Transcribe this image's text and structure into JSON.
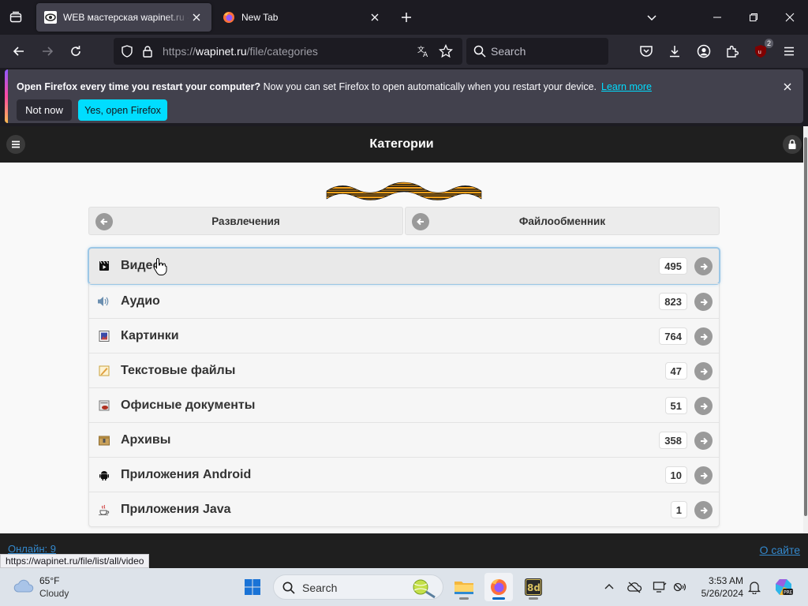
{
  "browser": {
    "tabs": [
      {
        "title": "WEB мастерская wapinet.ru - Ka",
        "active": true
      },
      {
        "title": "New Tab",
        "active": false
      }
    ],
    "url_prefix": "https://",
    "url_host": "wapinet.ru",
    "url_path": "/file/categories",
    "search_placeholder": "Search",
    "extensions_badge": "2"
  },
  "notification": {
    "bold_text": "Open Firefox every time you restart your computer?",
    "text": " Now you can set Firefox to open automatically when you restart your device.",
    "link": "Learn more",
    "not_now": "Not now",
    "yes": "Yes, open Firefox"
  },
  "page": {
    "title": "Категории",
    "prev_nav": "Развлечения",
    "next_nav": "Файлообменник",
    "categories": [
      {
        "label": "Видео",
        "count": "495",
        "icon": "video-icon"
      },
      {
        "label": "Аудио",
        "count": "823",
        "icon": "speaker-icon"
      },
      {
        "label": "Картинки",
        "count": "764",
        "icon": "picture-icon"
      },
      {
        "label": "Текстовые файлы",
        "count": "47",
        "icon": "text-file-icon"
      },
      {
        "label": "Офисные документы",
        "count": "51",
        "icon": "office-document-icon"
      },
      {
        "label": "Архивы",
        "count": "358",
        "icon": "archive-icon"
      },
      {
        "label": "Приложения Android",
        "count": "10",
        "icon": "android-icon"
      },
      {
        "label": "Приложения Java",
        "count": "1",
        "icon": "java-icon"
      }
    ],
    "online": "Онлайн: 9",
    "about": "О сайте",
    "status_url": "https://wapinet.ru/file/list/all/video"
  },
  "taskbar": {
    "temp": "65°F",
    "condition": "Cloudy",
    "search_placeholder": "Search",
    "time": "3:53 AM",
    "date": "5/26/2024"
  },
  "colors": {
    "accent": "#00ddff",
    "page_header": "#1f1f1f",
    "link": "#3388cc"
  }
}
